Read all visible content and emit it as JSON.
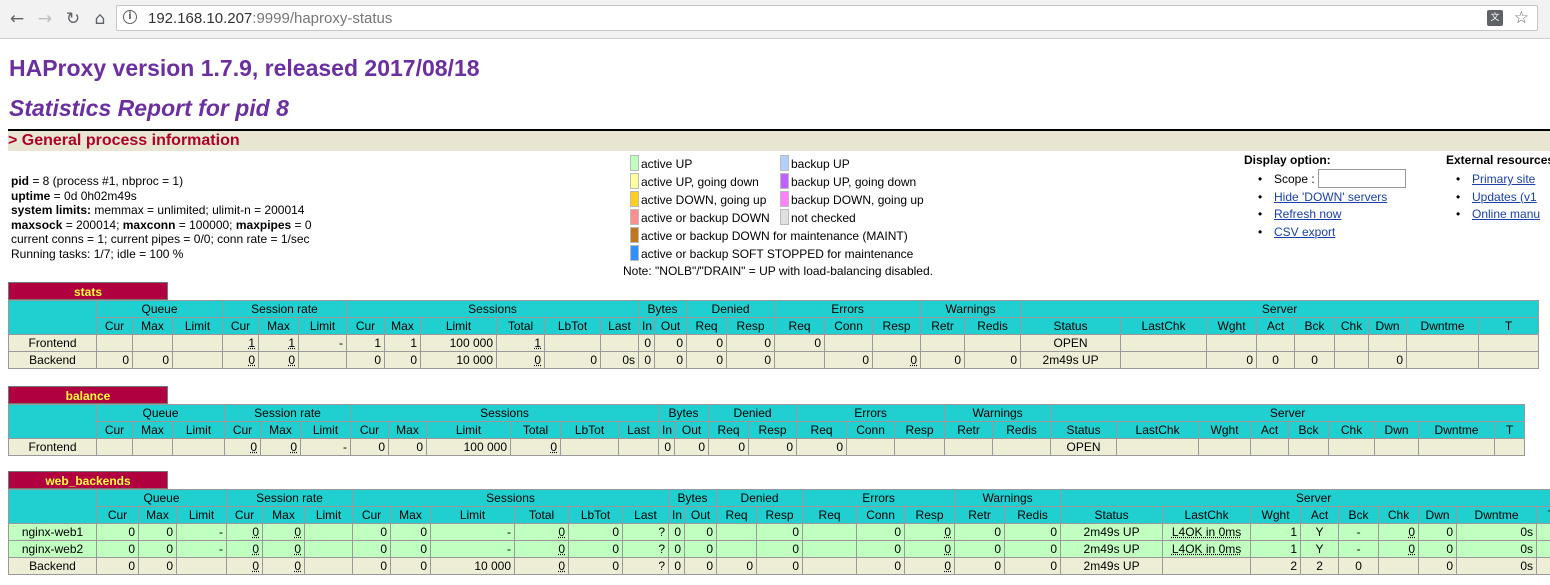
{
  "browser": {
    "url_host": "192.168.10.207",
    "url_rest": ":9999/haproxy-status",
    "back_icon": "arrow-left-icon",
    "forward_icon": "arrow-right-icon",
    "reload_icon": "reload-icon",
    "home_icon": "home-icon",
    "info_icon": "info-icon",
    "translate_icon": "translate-icon",
    "star_icon": "star-icon"
  },
  "page": {
    "title": "HAProxy version 1.7.9, released 2017/08/18",
    "subtitle": "Statistics Report for pid 8",
    "section": "> General process information"
  },
  "process": {
    "pid_label": "pid",
    "pid_value": " = 8 (process #1, nbproc = 1)",
    "uptime_label": "uptime",
    "uptime_value": " = 0d 0h02m49s",
    "limits_label": "system limits:",
    "limits_value": " memmax = unlimited; ulimit-n = 200014",
    "maxsock_label": "maxsock",
    "maxsock_value": " = 200014; ",
    "maxconn_label": "maxconn",
    "maxconn_value": " = 100000; ",
    "maxpipes_label": "maxpipes",
    "maxpipes_value": " = 0",
    "conns": "current conns = 1; current pipes = 0/0; conn rate = 1/sec",
    "tasks": "Running tasks: 1/7; idle = 100 %"
  },
  "legend": {
    "left": [
      {
        "label": "active UP",
        "color": "#c0ffc0"
      },
      {
        "label": "active UP, going down",
        "color": "#ffffa0"
      },
      {
        "label": "active DOWN, going up",
        "color": "#ffd020"
      },
      {
        "label": "active or backup DOWN",
        "color": "#ff9090"
      },
      {
        "label": "active or backup DOWN for maintenance (MAINT)",
        "color": "#c07820"
      },
      {
        "label": "active or backup SOFT STOPPED for maintenance",
        "color": "#3090ff"
      }
    ],
    "right": [
      {
        "label": "backup UP",
        "color": "#b0d0ff"
      },
      {
        "label": "backup UP, going down",
        "color": "#c060ff"
      },
      {
        "label": "backup DOWN, going up",
        "color": "#ff80ff"
      },
      {
        "label": "not checked",
        "color": "#e0e0e0"
      }
    ],
    "note": "Note: \"NOLB\"/\"DRAIN\" = UP with load-balancing disabled."
  },
  "display_option": {
    "heading": "Display option:",
    "scope_label": "Scope :",
    "scope_value": "",
    "hide_down": "Hide 'DOWN' servers",
    "refresh": "Refresh now",
    "csv": "CSV export"
  },
  "external": {
    "heading": "External resources:",
    "primary": "Primary site",
    "updates": "Updates (v1",
    "online": "Online manu"
  },
  "table_headers": {
    "groups": [
      "Queue",
      "Session rate",
      "Sessions",
      "Bytes",
      "Denied",
      "Errors",
      "Warnings",
      "Server"
    ],
    "cols": [
      "Cur",
      "Max",
      "Limit",
      "Cur",
      "Max",
      "Limit",
      "Cur",
      "Max",
      "Limit",
      "Total",
      "LbTot",
      "Last",
      "In",
      "Out",
      "Req",
      "Resp",
      "Req",
      "Conn",
      "Resp",
      "Retr",
      "Redis",
      "Status",
      "LastChk",
      "Wght",
      "Act",
      "Bck",
      "Chk",
      "Dwn",
      "Dwntme",
      "T"
    ]
  },
  "proxies": {
    "stats": {
      "name": "stats",
      "rows": [
        {
          "name": "Frontend",
          "cells": [
            "",
            "",
            "",
            "1",
            "1",
            "-",
            "1",
            "1",
            "100 000",
            "1",
            "",
            "",
            "0",
            "0",
            "0",
            "0",
            "0",
            "",
            "",
            "",
            "",
            "OPEN",
            "",
            "",
            "",
            "",
            "",
            "",
            "",
            ""
          ]
        },
        {
          "name": "Backend",
          "cells": [
            "0",
            "0",
            "",
            "0",
            "0",
            "",
            "0",
            "0",
            "10 000",
            "0",
            "0",
            "0s",
            "0",
            "0",
            "0",
            "0",
            "",
            "0",
            "0",
            "0",
            "0",
            "2m49s UP",
            "",
            "0",
            "0",
            "0",
            "",
            "0",
            "",
            ""
          ]
        }
      ]
    },
    "balance": {
      "name": "balance",
      "rows": [
        {
          "name": "Frontend",
          "cells": [
            "",
            "",
            "",
            "0",
            "0",
            "-",
            "0",
            "0",
            "100 000",
            "0",
            "",
            "",
            "0",
            "0",
            "0",
            "0",
            "0",
            "",
            "",
            "",
            "",
            "OPEN",
            "",
            "",
            "",
            "",
            "",
            "",
            "",
            ""
          ]
        }
      ]
    },
    "web_backends": {
      "name": "web_backends",
      "rows": [
        {
          "name": "nginx-web1",
          "cells": [
            "0",
            "0",
            "-",
            "0",
            "0",
            "",
            "0",
            "0",
            "-",
            "0",
            "0",
            "?",
            "0",
            "0",
            "",
            "0",
            "",
            "0",
            "0",
            "0",
            "0",
            "2m49s UP",
            "L4OK in 0ms",
            "1",
            "Y",
            "-",
            "0",
            "0",
            "0s",
            ""
          ]
        },
        {
          "name": "nginx-web2",
          "cells": [
            "0",
            "0",
            "-",
            "0",
            "0",
            "",
            "0",
            "0",
            "-",
            "0",
            "0",
            "?",
            "0",
            "0",
            "",
            "0",
            "",
            "0",
            "0",
            "0",
            "0",
            "2m49s UP",
            "L4OK in 0ms",
            "1",
            "Y",
            "-",
            "0",
            "0",
            "0s",
            ""
          ]
        },
        {
          "name": "Backend",
          "cells": [
            "0",
            "0",
            "",
            "0",
            "0",
            "",
            "0",
            "0",
            "10 000",
            "0",
            "0",
            "?",
            "0",
            "0",
            "0",
            "0",
            "",
            "0",
            "0",
            "0",
            "0",
            "2m49s UP",
            "",
            "2",
            "2",
            "0",
            "",
            "0",
            "0s",
            ""
          ]
        }
      ]
    }
  }
}
